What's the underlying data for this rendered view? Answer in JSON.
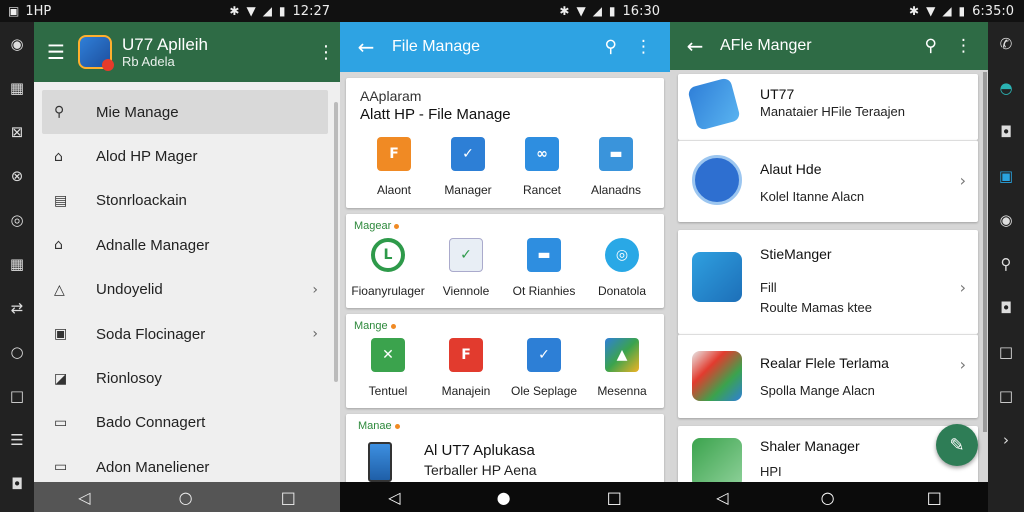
{
  "status": {
    "left": {
      "label": "1HP",
      "time": "12:27"
    },
    "middle": {
      "time": "16:30"
    },
    "right": {
      "time": "6:35:0"
    }
  },
  "rail_left_icons": [
    "circle-icon",
    "grid-icon",
    "grid-icon",
    "settings-icon",
    "camera-icon",
    "grid-icon",
    "share-icon",
    "home-icon",
    "square-icon",
    "list-icon",
    "bag-icon",
    "gear-icon"
  ],
  "drawer": {
    "title": "U77 Aplleih",
    "subtitle": "Rb Adela",
    "items": [
      {
        "label": "Mie Manage",
        "selected": true,
        "chevron": false
      },
      {
        "label": "Alod HP Mager",
        "chevron": false
      },
      {
        "label": "Stonrloackain",
        "chevron": false
      },
      {
        "label": "Adnalle Manager",
        "chevron": false
      },
      {
        "label": "Undoyelid",
        "chevron": true
      },
      {
        "label": "Soda Flocinager",
        "chevron": true
      },
      {
        "label": "Rionlosoy",
        "chevron": false
      },
      {
        "label": "Bado Connagert",
        "chevron": false
      },
      {
        "label": "Adon Maneliener",
        "chevron": false
      }
    ]
  },
  "panel2": {
    "title": "File Manage",
    "card1": {
      "subtitle": "AAplaram",
      "heading": "Alatt HP - File Manage",
      "apps": [
        "Alaont",
        "Manager",
        "Rancet",
        "Alanadns"
      ]
    },
    "card2": {
      "category": "Magear",
      "apps": [
        "Fioanyrulager",
        "Viennole",
        "Ot Rianhies",
        "Donatola"
      ]
    },
    "card3": {
      "category": "Mange",
      "apps": [
        "Tentuel",
        "Manajein",
        "Ole Seplage",
        "Mesenna"
      ]
    },
    "card4": {
      "category": "Manae",
      "title": "Al UT7 Aplukasa",
      "subtitle": "Terballer HP Aena"
    }
  },
  "panel3": {
    "title": "AFle Manger",
    "cards": [
      {
        "title": "UT77",
        "subtitle": "Manataier HFile Teraajen"
      },
      {
        "title": "Alaut Hde",
        "subtitle": "Kolel Itanne Alacn"
      },
      {
        "title": "StieManger",
        "subtitle": "Fill",
        "subtitle2": "Roulte Mamas ktee"
      },
      {
        "title": "Realar Flele Terlama",
        "subtitle": "Spolla Mange Alacn"
      },
      {
        "title": "Shaler Manager",
        "subtitle": "HPI"
      }
    ]
  },
  "colors": {
    "green_header": "#2e6b45",
    "blue_header": "#2ea3e3",
    "fab": "#2e7d56"
  }
}
